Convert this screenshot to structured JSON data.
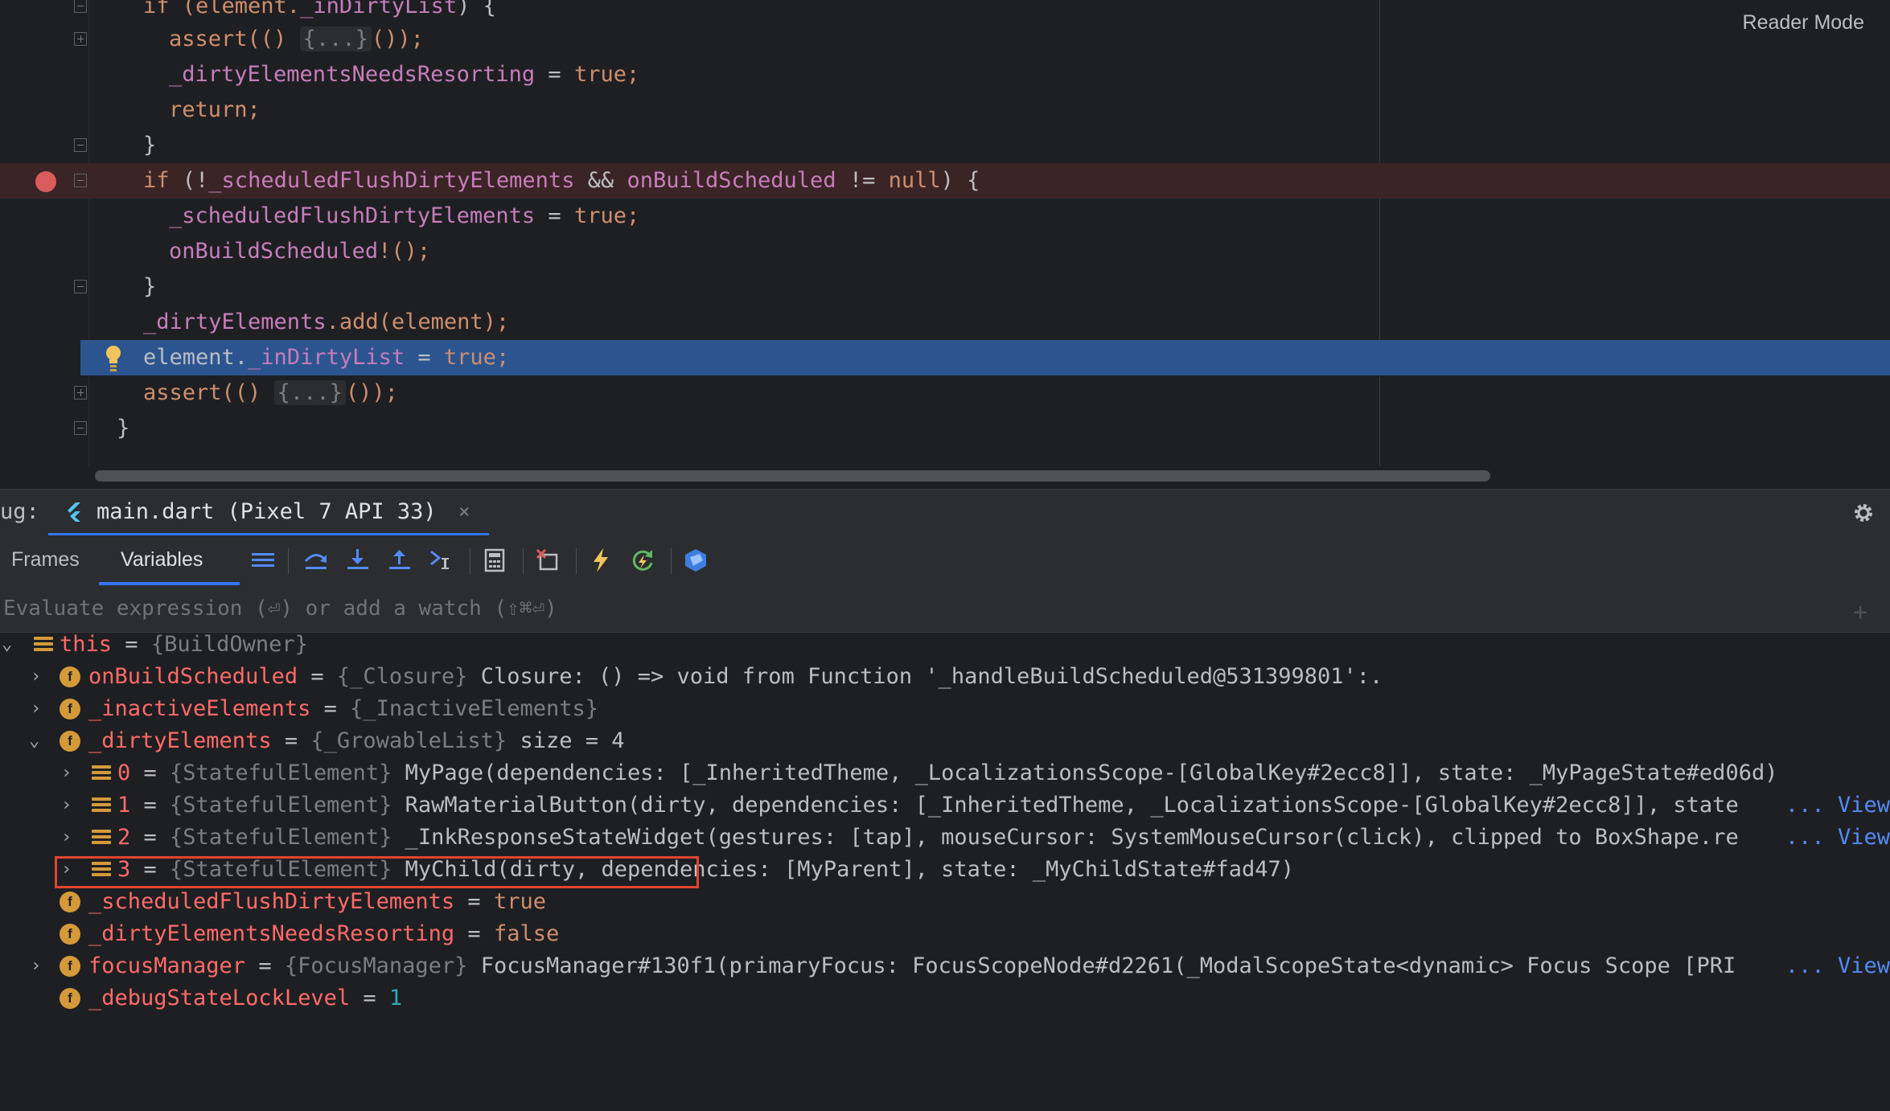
{
  "editor": {
    "reader_mode": "Reader Mode",
    "lines": [
      {
        "text_a": "if (element.",
        "text_b": "_inDirtyList",
        "text_c": ") {"
      },
      {
        "t1": "assert(() ",
        "t2": "{...}",
        "t3": "());"
      },
      {
        "t1": "_dirtyElementsNeedsResorting",
        "t2": " = ",
        "t3": "true",
        "t4": ";"
      },
      {
        "t1": "return",
        "t2": ";"
      },
      {
        "t1": "}"
      },
      {
        "t1": "if",
        "t2": " (!",
        "t3": "_scheduledFlushDirtyElements",
        "t4": " && ",
        "t5": "onBuildScheduled",
        "t6": " != ",
        "t7": "null",
        "t8": ") {"
      },
      {
        "t1": "_scheduledFlushDirtyElements",
        "t2": " = ",
        "t3": "true",
        "t4": ";"
      },
      {
        "t1": "onBuildScheduled",
        "t2": "!();"
      },
      {
        "t1": "}"
      },
      {
        "t1": "_dirtyElements",
        "t2": ".add(element);"
      },
      {
        "t1": "element.",
        "t2": "_inDirtyList",
        "t3": " = ",
        "t4": "true",
        "t5": ";"
      },
      {
        "t1": "assert(() ",
        "t2": "{...}",
        "t3": "());"
      },
      {
        "t1": "}"
      }
    ]
  },
  "debug": {
    "label": "ug:",
    "session_tab": "main.dart (Pixel 7 API 33)",
    "close": "×",
    "tabs": {
      "frames": "Frames",
      "variables": "Variables"
    },
    "eval_placeholder": "Evaluate expression (⏎) or add a watch (⇧⌘⏎)",
    "add_watch": "+"
  },
  "variables": {
    "this": {
      "name": "this",
      "eq": " = ",
      "type": "{BuildOwner}"
    },
    "onBuildScheduled": {
      "name": "onBuildScheduled",
      "eq": " = ",
      "type": "{_Closure}",
      "value": " Closure: () => void from Function '_handleBuildScheduled@531399801':."
    },
    "inactiveElements": {
      "name": "_inactiveElements",
      "eq": " = ",
      "type": "{_InactiveElements}"
    },
    "dirtyElements": {
      "name": "_dirtyElements",
      "eq": " = ",
      "type": "{_GrowableList}",
      "value": " size = 4"
    },
    "item0": {
      "name": "0",
      "eq": " = ",
      "type": "{StatefulElement}",
      "value": " MyPage(dependencies: [_InheritedTheme, _LocalizationsScope-[GlobalKey#2ecc8]], state: _MyPageState#ed06d)"
    },
    "item1": {
      "name": "1",
      "eq": " = ",
      "type": "{StatefulElement}",
      "value": " RawMaterialButton(dirty, dependencies: [_InheritedTheme, _LocalizationsScope-[GlobalKey#2ecc8]], state",
      "ellipsis": "...",
      "view": "View"
    },
    "item2": {
      "name": "2",
      "eq": " = ",
      "type": "{StatefulElement}",
      "value": " _InkResponseStateWidget(gestures: [tap], mouseCursor: SystemMouseCursor(click), clipped to BoxShape.re",
      "ellipsis": "...",
      "view": "View"
    },
    "item3": {
      "name": "3",
      "eq": " = ",
      "type": "{StatefulElement}",
      "value": " MyChild(dirty, dependencies: [MyParent], state: _MyChildState#fad47)"
    },
    "scheduledFlush": {
      "name": "_scheduledFlushDirtyElements",
      "eq": " = ",
      "value": "true"
    },
    "needsResorting": {
      "name": "_dirtyElementsNeedsResorting",
      "eq": " = ",
      "value": "false"
    },
    "focusManager": {
      "name": "focusManager",
      "eq": " = ",
      "type": "{FocusManager}",
      "value": " FocusManager#130f1(primaryFocus: FocusScopeNode#d2261(_ModalScopeState<dynamic> Focus Scope [PRI",
      "ellipsis": "...",
      "view": "View"
    },
    "debugLock": {
      "name": "_debugStateLockLevel",
      "eq": " = ",
      "value": "1"
    }
  },
  "icons": {
    "breakpoint": "breakpoint-icon",
    "bulb": "lightbulb-icon",
    "field": "f",
    "colors": {
      "accent": "#3574f0",
      "breakpoint": "#db5c5c",
      "highlight": "#2c5590",
      "keyword": "#cf8e6d",
      "field": "#c77dbb",
      "var_name": "#ff6b68"
    }
  }
}
